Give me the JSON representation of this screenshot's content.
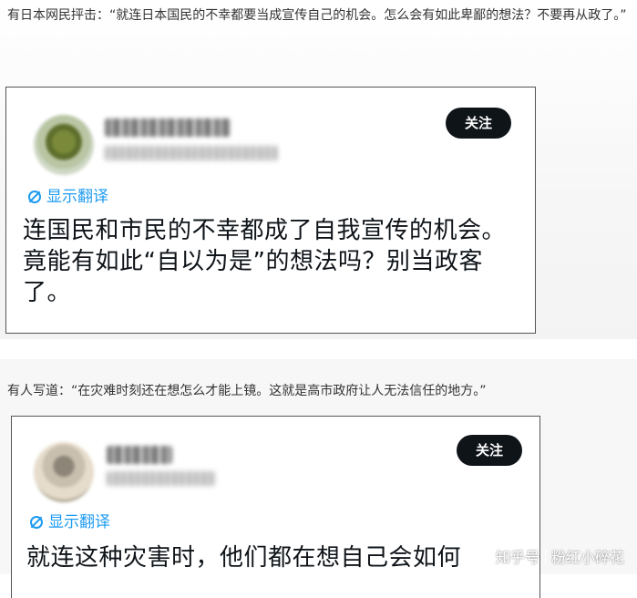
{
  "sections": [
    {
      "quote": "有日本网民抨击：“就连日本国民的不幸都要当成宣传自己的机会。怎么会有如此卑鄙的想法？不要再从政了。”",
      "card": {
        "follow_label": "关注",
        "translate_label": "显示翻译",
        "tweet_text": "连国民和市民的不幸都成了自我宣传的机会。竟能有如此“自以为是”的想法吗？别当政客了。"
      }
    },
    {
      "quote": "有人写道：“在灾难时刻还在想怎么才能上镜。这就是高市政府让人无法信任的地方。”",
      "card": {
        "follow_label": "关注",
        "translate_label": "显示翻译",
        "tweet_text": "就连这种灾害时，他们都在想自己会如何"
      }
    }
  ],
  "watermark": {
    "platform": "知乎号",
    "author": "粉红小碎花"
  }
}
